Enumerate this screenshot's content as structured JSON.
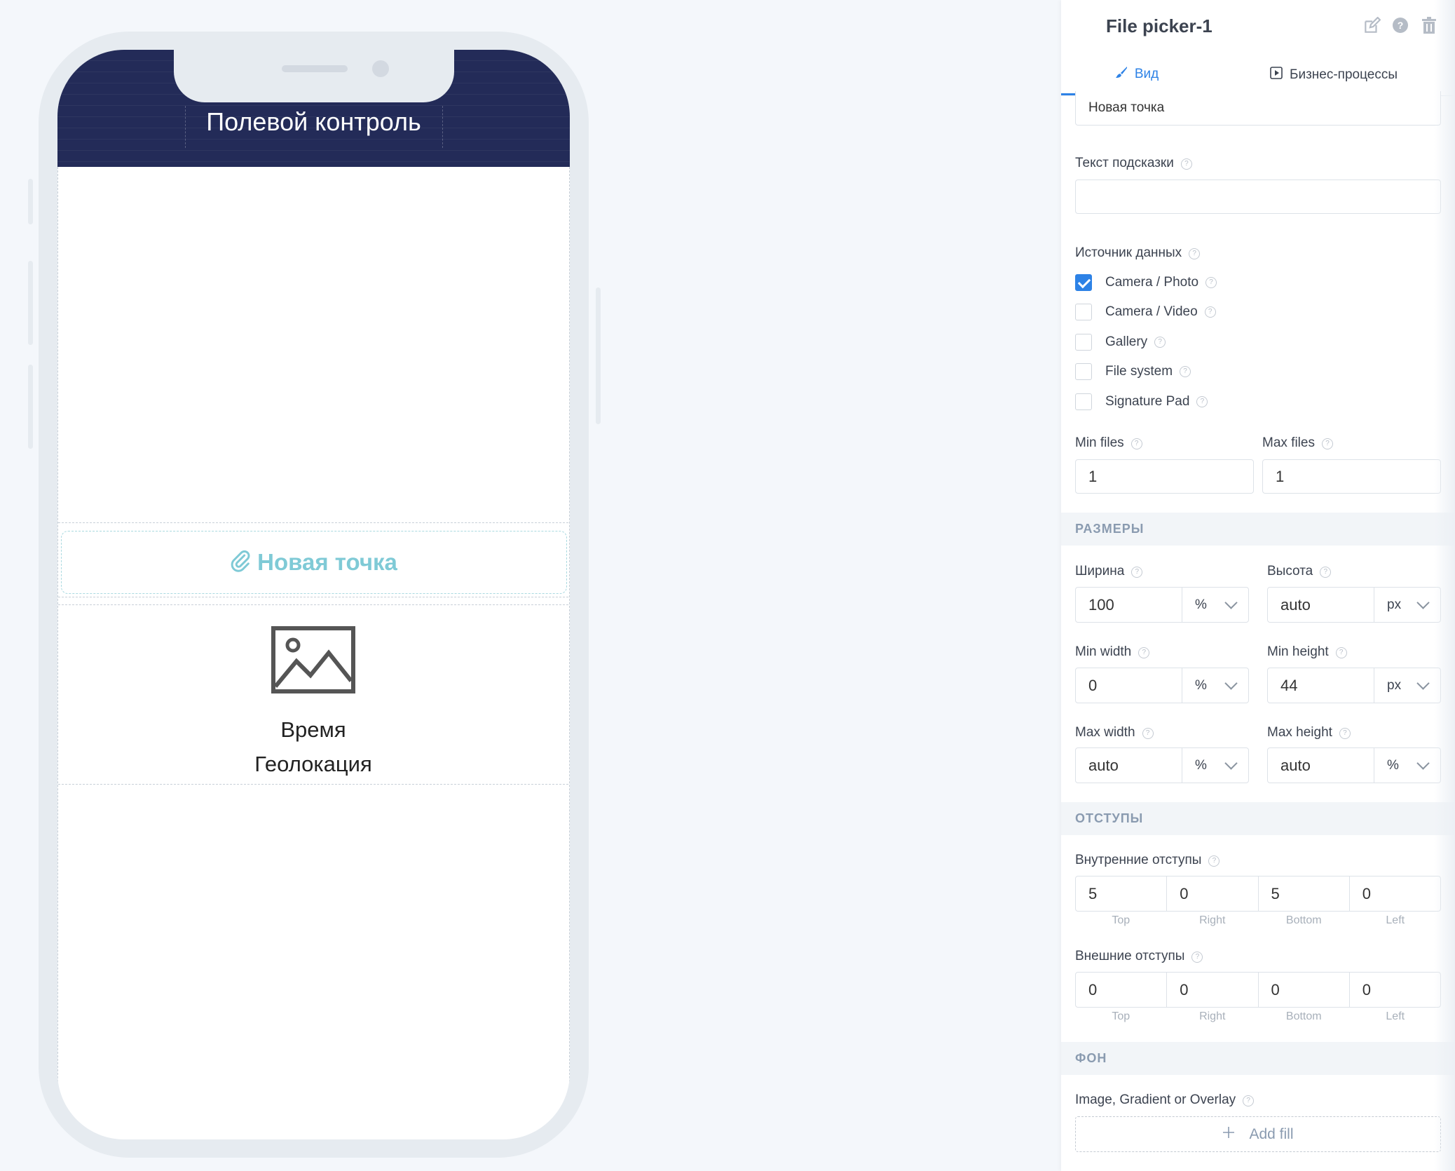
{
  "phone": {
    "app_title": "Полевой контроль",
    "file_picker_label": "Новая точка",
    "caption_line1": "Время",
    "caption_line2": "Геолокация"
  },
  "panel": {
    "title": "File picker-1",
    "icons": [
      "edit-icon",
      "help-icon",
      "trash-icon"
    ],
    "tabs": [
      {
        "label": "Вид",
        "icon": "brush-icon",
        "active": true
      },
      {
        "label": "Бизнес-процессы",
        "icon": "play-square-icon",
        "active": false
      }
    ],
    "text_value": "Новая точка",
    "hint_label": "Текст подсказки",
    "hint_value": "",
    "data_source_label": "Источник данных",
    "sources": [
      {
        "label": "Camera / Photo",
        "checked": true
      },
      {
        "label": "Camera / Video",
        "checked": false
      },
      {
        "label": "Gallery",
        "checked": false
      },
      {
        "label": "File system",
        "checked": false
      },
      {
        "label": "Signature Pad",
        "checked": false
      }
    ],
    "min_files_label": "Min files",
    "min_files": "1",
    "max_files_label": "Max files",
    "max_files": "1",
    "sizes_section": "РАЗМЕРЫ",
    "width_label": "Ширина",
    "width_value": "100",
    "width_unit": "%",
    "height_label": "Высота",
    "height_value": "auto",
    "height_unit": "px",
    "min_width_label": "Min width",
    "min_width_value": "0",
    "min_width_unit": "%",
    "min_height_label": "Min height",
    "min_height_value": "44",
    "min_height_unit": "px",
    "max_width_label": "Max width",
    "max_width_value": "auto",
    "max_width_unit": "%",
    "max_height_label": "Max height",
    "max_height_value": "auto",
    "max_height_unit": "%",
    "spacing_section": "ОТСТУПЫ",
    "padding_label": "Внутренние отступы",
    "padding": [
      "5",
      "0",
      "5",
      "0"
    ],
    "margin_label": "Внешние отступы",
    "margin": [
      "0",
      "0",
      "0",
      "0"
    ],
    "side_labels": [
      "Top",
      "Right",
      "Bottom",
      "Left"
    ],
    "background_section": "ФОН",
    "fill_label": "Image, Gradient or Overlay",
    "add_fill": "Add fill"
  },
  "colors": {
    "header_bg": "#232b58",
    "accent": "#2d82e6",
    "picker_text": "#7fcad6"
  }
}
